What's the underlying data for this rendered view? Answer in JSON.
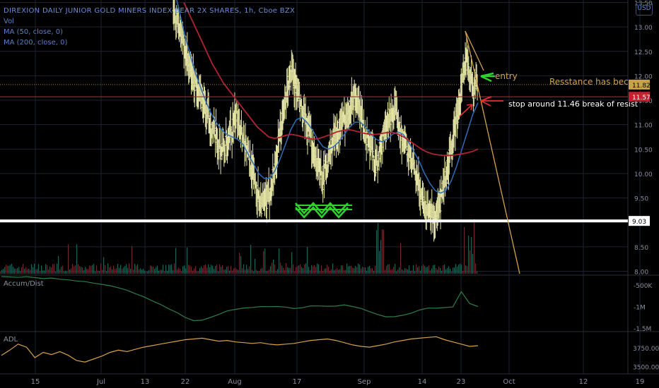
{
  "legend": {
    "symbol": "DIREXION DAILY JUNIOR GOLD MINERS INDEX BEAR 2X SHARES, 1h, Cboe BZX",
    "vol": "Vol",
    "ma50": "MA (50, close, 0)",
    "ma200": "MA (200, close, 0)"
  },
  "currency_button": "USD",
  "panes": {
    "accum_label": "Accum/Dist",
    "adl_label": "ADL"
  },
  "colors": {
    "background": "#000000",
    "grid": "#1e2230",
    "price_bar": "#e6e6a6",
    "ma50": "#2e6eb8",
    "ma200": "#b22330",
    "support": "#ffffff",
    "resistance": "#b22330",
    "trend": "#d4a24c",
    "annotation_green": "#2ed32e",
    "accum_line": "#2f7d4a",
    "adl_line": "#d4a24c",
    "axis_text": "#8b90a0"
  },
  "annotations": {
    "entry": "entry",
    "resistance": "Resstance has become",
    "stop": "stop around 11.46 break of resist"
  },
  "chart_data": [
    {
      "type": "candlestick",
      "title": "DIREXION DAILY JUNIOR GOLD MINERS INDEX BEAR 2X SHARES, 1h, Cboe BZX",
      "ylim": [
        7.95,
        13.55
      ],
      "y_ticks": [
        "13.50",
        "13.00",
        "12.50",
        "12.00",
        "11.50",
        "11.00",
        "10.50",
        "10.00",
        "9.50",
        "9.00",
        "8.50",
        "8.00"
      ],
      "x_ticks": [
        "15",
        "Jul",
        "13",
        "22",
        "Aug",
        "17",
        "Sep",
        "14",
        "23",
        "Oct",
        "12",
        "19"
      ],
      "price_labels": {
        "last": "11.82",
        "resistance": "11.57",
        "support": "9.03"
      },
      "levels": {
        "resistance": 11.57,
        "support": 9.03,
        "last": 11.82
      },
      "close": [
        13.2,
        13.05,
        12.6,
        12.2,
        11.9,
        11.6,
        11.3,
        11.0,
        10.7,
        10.5,
        10.55,
        10.9,
        11.2,
        10.8,
        10.4,
        10.0,
        9.5,
        9.3,
        9.6,
        10.1,
        10.8,
        11.5,
        12.1,
        11.7,
        11.3,
        10.9,
        10.6,
        10.2,
        9.9,
        10.3,
        10.7,
        10.9,
        11.1,
        11.4,
        11.6,
        11.2,
        10.8,
        10.5,
        10.2,
        10.6,
        11.0,
        11.3,
        11.1,
        10.7,
        10.4,
        10.1,
        9.7,
        9.4,
        9.2,
        9.1,
        9.4,
        9.9,
        10.5,
        11.1,
        11.8,
        12.4,
        11.8,
        11.9
      ],
      "ma50": [
        13.8,
        13.4,
        12.9,
        12.5,
        12.1,
        11.8,
        11.5,
        11.25,
        11.05,
        10.9,
        10.8,
        10.75,
        10.7,
        10.6,
        10.4,
        10.2,
        10.0,
        9.9,
        9.9,
        10.05,
        10.3,
        10.6,
        10.9,
        11.1,
        11.15,
        11.05,
        10.9,
        10.7,
        10.55,
        10.5,
        10.55,
        10.65,
        10.8,
        10.95,
        11.05,
        11.05,
        10.95,
        10.8,
        10.7,
        10.65,
        10.7,
        10.8,
        10.85,
        10.8,
        10.65,
        10.45,
        10.25,
        10.0,
        9.8,
        9.65,
        9.6,
        9.65,
        9.85,
        10.15,
        10.5,
        10.85,
        11.2,
        11.45
      ],
      "ma200": [
        null,
        null,
        null,
        null,
        null,
        13.5,
        13.25,
        13.0,
        12.75,
        12.5,
        12.25,
        12.05,
        11.85,
        11.7,
        11.55,
        11.4,
        11.25,
        11.1,
        10.95,
        10.85,
        10.75,
        10.72,
        10.74,
        10.78,
        10.8,
        10.78,
        10.75,
        10.72,
        10.7,
        10.72,
        10.76,
        10.8,
        10.85,
        10.88,
        10.9,
        10.88,
        10.85,
        10.82,
        10.8,
        10.8,
        10.82,
        10.84,
        10.84,
        10.8,
        10.74,
        10.66,
        10.58,
        10.5,
        10.44,
        10.4,
        10.38,
        10.37,
        10.37,
        10.38,
        10.4,
        10.42,
        10.45,
        10.5
      ]
    },
    {
      "type": "line",
      "title": "Accum/Dist",
      "y_ticks": [
        "-500K",
        "-1M",
        "-1.5M"
      ],
      "ylim": [
        -1550000,
        -300000
      ],
      "values": [
        -290000,
        -300000,
        -320000,
        -310000,
        -330000,
        -350000,
        -340000,
        -360000,
        -380000,
        -400000,
        -420000,
        -450000,
        -480000,
        -520000,
        -560000,
        -620000,
        -700000,
        -780000,
        -860000,
        -940000,
        -1050000,
        -1150000,
        -1250000,
        -1320000,
        -1310000,
        -1250000,
        -1180000,
        -1100000,
        -1060000,
        -1040000,
        -1020000,
        -1010000,
        -1000000,
        -990000,
        -1010000,
        -1040000,
        -1020000,
        -980000,
        -990000,
        -1000000,
        -980000,
        -960000,
        -1000000,
        -1050000,
        -1110000,
        -1180000,
        -1230000,
        -1240000,
        -1200000,
        -1150000,
        -1080000,
        -1040000,
        -1030000,
        -1020000,
        -1000000,
        -650000,
        -920000,
        -1000000
      ]
    },
    {
      "type": "line",
      "title": "ADL",
      "y_ticks": [
        "3750.00",
        "3500.00"
      ],
      "ylim": [
        3420,
        3950
      ],
      "values": [
        3650,
        3720,
        3800,
        3760,
        3620,
        3690,
        3660,
        3700,
        3650,
        3580,
        3560,
        3600,
        3640,
        3690,
        3720,
        3700,
        3730,
        3760,
        3780,
        3800,
        3820,
        3840,
        3860,
        3870,
        3880,
        3860,
        3840,
        3850,
        3830,
        3820,
        3810,
        3820,
        3800,
        3790,
        3800,
        3810,
        3830,
        3850,
        3860,
        3870,
        3850,
        3820,
        3790,
        3770,
        3760,
        3780,
        3800,
        3830,
        3850,
        3870,
        3880,
        3890,
        3900,
        3860,
        3830,
        3800,
        3770,
        3780
      ]
    }
  ]
}
